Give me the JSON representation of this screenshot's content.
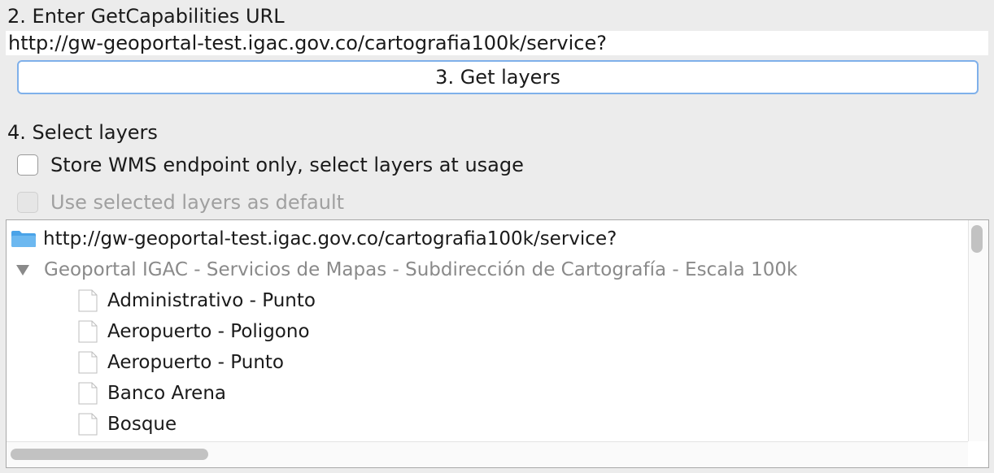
{
  "step2": {
    "label": "2. Enter GetCapabilities URL",
    "url_value": "http://gw-geoportal-test.igac.gov.co/cartografia100k/service?"
  },
  "get_layers_button": "3. Get layers",
  "step4": {
    "label": "4. Select layers",
    "store_endpoint_label": "Store WMS endpoint only, select layers at usage",
    "store_endpoint_checked": false,
    "use_default_label": "Use selected layers as default",
    "use_default_enabled": false
  },
  "tree": {
    "root_label": "http://gw-geoportal-test.igac.gov.co/cartografia100k/service?",
    "root_icon": "folder-icon",
    "group_label": "Geoportal IGAC - Servicios de Mapas - Subdirección de Cartografía - Escala 100k",
    "group_expanded": true,
    "layers": [
      "Administrativo - Punto",
      "Aeropuerto - Poligono",
      "Aeropuerto - Punto",
      "Banco Arena",
      "Bosque"
    ],
    "layer_icon": "file-icon"
  },
  "colors": {
    "accent_border": "#7fb0ea",
    "folder_blue": "#4aa3e8",
    "disabled_text": "#a0a0a0",
    "background": "#ececec"
  }
}
